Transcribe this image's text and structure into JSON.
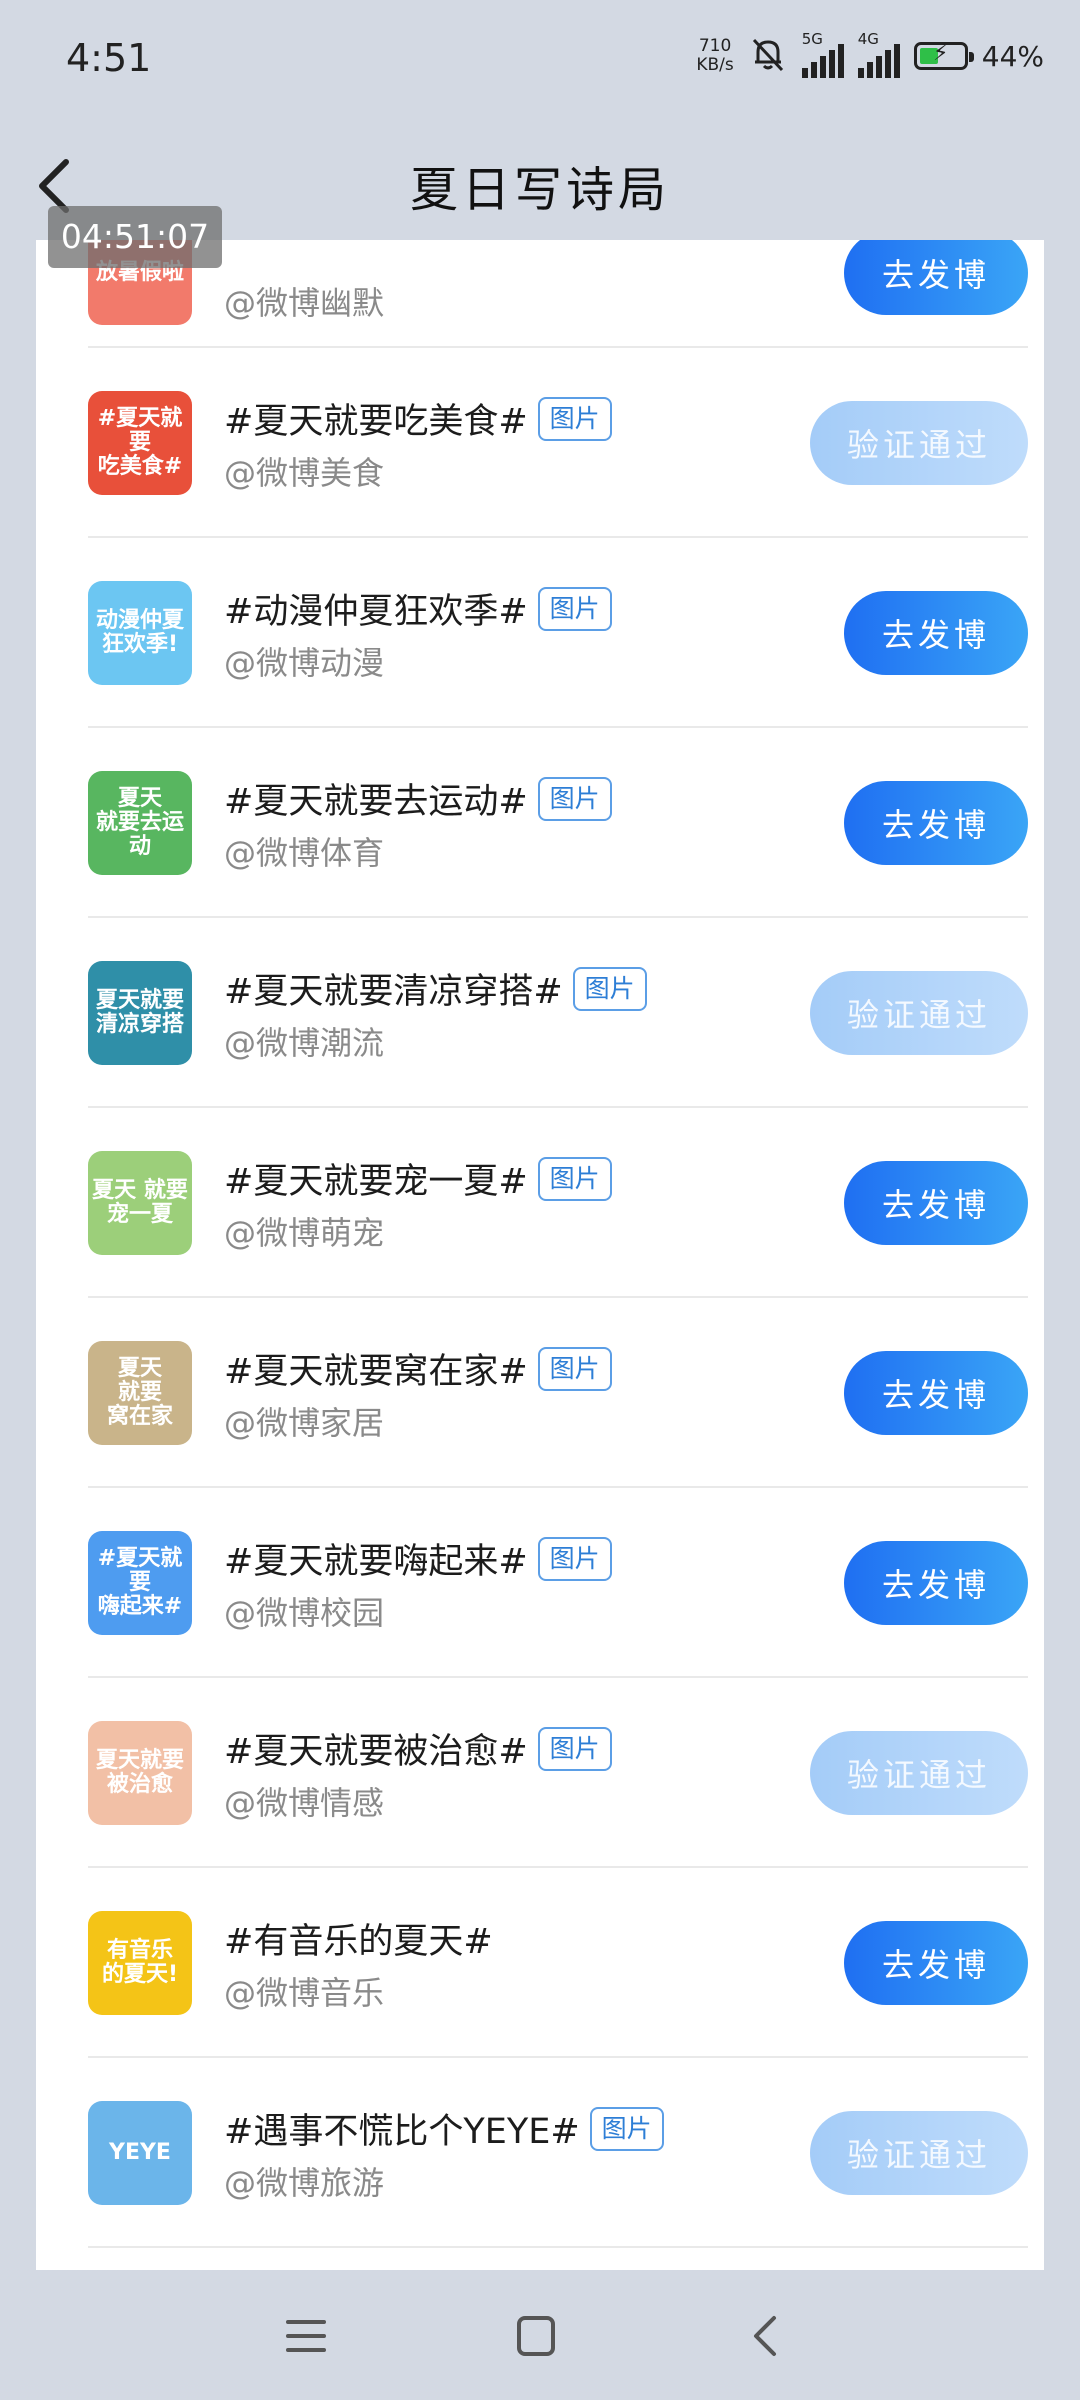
{
  "status_bar": {
    "time": "4:51",
    "net_speed_value": "710",
    "net_speed_unit": "KB/s",
    "sim1_label": "5G",
    "sim2_label": "4G",
    "battery_level": 0.44,
    "battery_percent": "44%"
  },
  "header": {
    "title": "夏日写诗局",
    "back_icon": "back-arrow-icon"
  },
  "overlay_clock": "04:51:07",
  "topics": [
    {
      "title": "#夏天就要吃美食#",
      "tag": "图片",
      "account": "@微博美食",
      "action": "验证通过",
      "state": "verified",
      "thumb_text": "#夏天就要\n吃美食#",
      "thumb_color": "#e8503a"
    },
    {
      "title": "#动漫仲夏狂欢季#",
      "tag": "图片",
      "account": "@微博动漫",
      "action": "去发博",
      "state": "post",
      "thumb_text": "动漫仲夏\n狂欢季!",
      "thumb_color": "#6cc6f2"
    },
    {
      "title": "#夏天就要去运动#",
      "tag": "图片",
      "account": "@微博体育",
      "action": "去发博",
      "state": "post",
      "thumb_text": "夏天\n就要去运动",
      "thumb_color": "#58b660"
    },
    {
      "title": "#夏天就要清凉穿搭#",
      "tag": "图片",
      "account": "@微博潮流",
      "action": "验证通过",
      "state": "verified",
      "thumb_text": "夏天就要\n清凉穿搭",
      "thumb_color": "#2f8fa8"
    },
    {
      "title": "#夏天就要宠一夏#",
      "tag": "图片",
      "account": "@微博萌宠",
      "action": "去发博",
      "state": "post",
      "thumb_text": "夏天 就要\n宠一夏",
      "thumb_color": "#9ccf7a"
    },
    {
      "title": "#夏天就要窝在家#",
      "tag": "图片",
      "account": "@微博家居",
      "action": "去发博",
      "state": "post",
      "thumb_text": "夏天\n就要\n窝在家",
      "thumb_color": "#c9b48a"
    },
    {
      "title": "#夏天就要嗨起来#",
      "tag": "图片",
      "account": "@微博校园",
      "action": "去发博",
      "state": "post",
      "thumb_text": "#夏天就要\n嗨起来#",
      "thumb_color": "#4e9cf0"
    },
    {
      "title": "#夏天就要被治愈#",
      "tag": "图片",
      "account": "@微博情感",
      "action": "验证通过",
      "state": "verified",
      "thumb_text": "夏天就要\n被治愈",
      "thumb_color": "#f2c0a6"
    },
    {
      "title": "#有音乐的夏天#",
      "tag": "",
      "account": "@微博音乐",
      "action": "去发博",
      "state": "post",
      "thumb_text": "有音乐\n的夏天!",
      "thumb_color": "#f4c417"
    },
    {
      "title": "#遇事不慌比个YEYE#",
      "tag": "图片",
      "account": "@微博旅游",
      "action": "验证通过",
      "state": "verified",
      "thumb_text": "YEYE",
      "thumb_color": "#6bb5ea"
    }
  ],
  "partial_row": {
    "account": "@微博幽默",
    "action": "去发博",
    "thumb_text": "放暑假啦",
    "thumb_color": "#f27a6b"
  },
  "nav_bar": {
    "menu_icon": "menu-icon",
    "home_icon": "home-square-icon",
    "back_icon": "nav-back-icon"
  }
}
